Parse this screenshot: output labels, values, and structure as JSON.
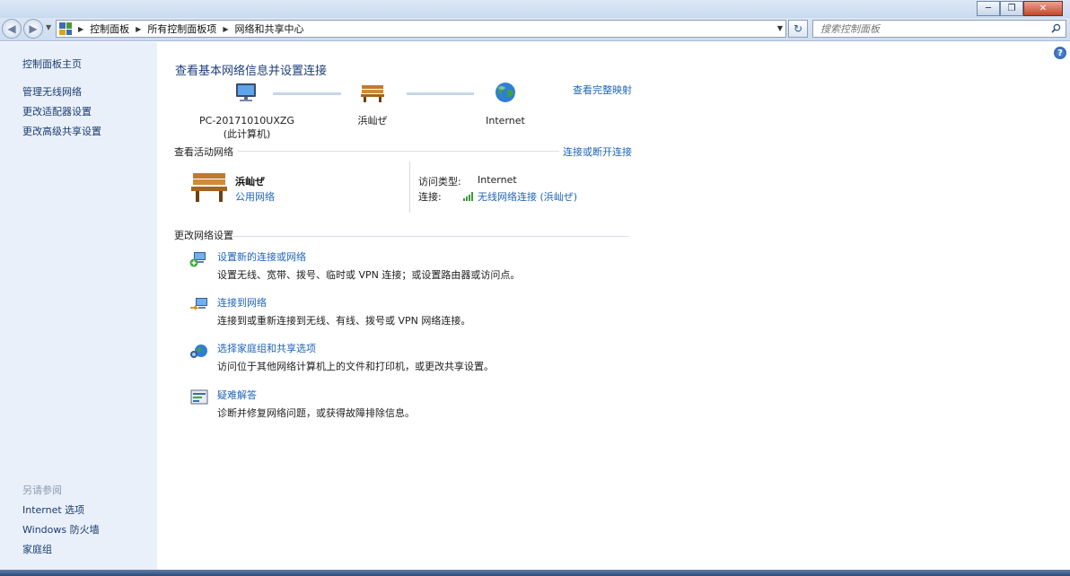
{
  "window": {
    "minimize_glyph": "─",
    "maximize_glyph": "❐",
    "close_glyph": "✕"
  },
  "nav": {
    "back_glyph": "◀",
    "forward_glyph": "▶",
    "breadcrumb": [
      "控制面板",
      "所有控制面板项",
      "网络和共享中心"
    ],
    "search_placeholder": "搜索控制面板",
    "refresh_glyph": "↻"
  },
  "left": {
    "links": [
      "控制面板主页",
      "管理无线网络",
      "更改适配器设置",
      "更改高级共享设置"
    ],
    "see_also_heading": "另请参阅",
    "see_also": [
      "Internet 选项",
      "Windows 防火墙",
      "家庭组"
    ]
  },
  "main": {
    "help_glyph": "?",
    "title": "查看基本网络信息并设置连接",
    "full_map_link": "查看完整映射",
    "nodes": {
      "computer_name": "PC-20171010UXZG",
      "computer_sub": "(此计算机)",
      "network_name": "浜屾ぜ",
      "internet": "Internet"
    },
    "active_section": {
      "heading": "查看活动网络",
      "connect_link": "连接或断开连接",
      "network_name": "浜屾ぜ",
      "network_type": "公用网络",
      "access_type_label": "访问类型:",
      "access_type_value": "Internet",
      "connection_label": "连接:",
      "connection_value": "无线网络连接 (浜屾ぜ)"
    },
    "change_section": {
      "heading": "更改网络设置",
      "tasks": [
        {
          "icon": "network-setup-icon",
          "title": "设置新的连接或网络",
          "desc": "设置无线、宽带、拨号、临时或 VPN 连接；或设置路由器或访问点。"
        },
        {
          "icon": "connect-network-icon",
          "title": "连接到网络",
          "desc": "连接到或重新连接到无线、有线、拨号或 VPN 网络连接。"
        },
        {
          "icon": "homegroup-icon",
          "title": "选择家庭组和共享选项",
          "desc": "访问位于其他网络计算机上的文件和打印机，或更改共享设置。"
        },
        {
          "icon": "troubleshoot-icon",
          "title": "疑难解答",
          "desc": "诊断并修复网络问题，或获得故障排除信息。"
        }
      ]
    }
  }
}
